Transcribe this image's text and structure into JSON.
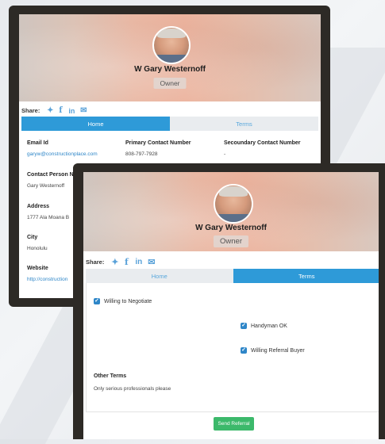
{
  "profile": {
    "name": "W Gary Westernoff",
    "role": "Owner"
  },
  "share": {
    "label": "Share:",
    "icons": [
      "twitter-icon",
      "facebook-icon",
      "linkedin-icon",
      "email-icon"
    ]
  },
  "tabs": [
    "Home",
    "Terms"
  ],
  "home": {
    "email_label": "Email Id",
    "email_value": "garyw@constructionplace.com",
    "primary_label": "Primary Contact Number",
    "primary_value": "808-797-7928",
    "secondary_label": "Secoundary Contact Number",
    "secondary_value": "-",
    "contact_label": "Contact Person N",
    "contact_value": "Gary Westernoff",
    "address_label": "Address",
    "address_value": "1777 Ala Moana B",
    "city_label": "City",
    "city_value": "Honolulu",
    "website_label": "Website",
    "website_value": "http://construction"
  },
  "terms": {
    "items": [
      "Willing to Negotiate",
      "Handyman OK",
      "Willing Referral Buyer"
    ],
    "other_label": "Other Terms",
    "other_value": "Only serious professionals please",
    "send_button": "Send Referral"
  },
  "colors": {
    "accent": "#2e9ad8",
    "link": "#2e86c8",
    "button": "#3cb96b",
    "frame": "#2d2a26"
  }
}
